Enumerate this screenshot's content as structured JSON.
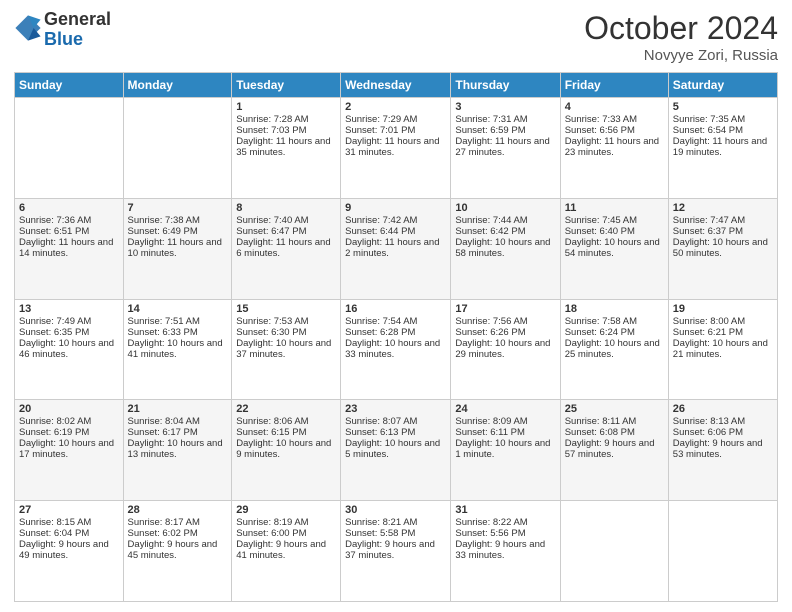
{
  "header": {
    "logo_general": "General",
    "logo_blue": "Blue",
    "month_title": "October 2024",
    "location": "Novyye Zori, Russia"
  },
  "days_of_week": [
    "Sunday",
    "Monday",
    "Tuesday",
    "Wednesday",
    "Thursday",
    "Friday",
    "Saturday"
  ],
  "weeks": [
    [
      {
        "day": "",
        "sunrise": "",
        "sunset": "",
        "daylight": ""
      },
      {
        "day": "",
        "sunrise": "",
        "sunset": "",
        "daylight": ""
      },
      {
        "day": "1",
        "sunrise": "Sunrise: 7:28 AM",
        "sunset": "Sunset: 7:03 PM",
        "daylight": "Daylight: 11 hours and 35 minutes."
      },
      {
        "day": "2",
        "sunrise": "Sunrise: 7:29 AM",
        "sunset": "Sunset: 7:01 PM",
        "daylight": "Daylight: 11 hours and 31 minutes."
      },
      {
        "day": "3",
        "sunrise": "Sunrise: 7:31 AM",
        "sunset": "Sunset: 6:59 PM",
        "daylight": "Daylight: 11 hours and 27 minutes."
      },
      {
        "day": "4",
        "sunrise": "Sunrise: 7:33 AM",
        "sunset": "Sunset: 6:56 PM",
        "daylight": "Daylight: 11 hours and 23 minutes."
      },
      {
        "day": "5",
        "sunrise": "Sunrise: 7:35 AM",
        "sunset": "Sunset: 6:54 PM",
        "daylight": "Daylight: 11 hours and 19 minutes."
      }
    ],
    [
      {
        "day": "6",
        "sunrise": "Sunrise: 7:36 AM",
        "sunset": "Sunset: 6:51 PM",
        "daylight": "Daylight: 11 hours and 14 minutes."
      },
      {
        "day": "7",
        "sunrise": "Sunrise: 7:38 AM",
        "sunset": "Sunset: 6:49 PM",
        "daylight": "Daylight: 11 hours and 10 minutes."
      },
      {
        "day": "8",
        "sunrise": "Sunrise: 7:40 AM",
        "sunset": "Sunset: 6:47 PM",
        "daylight": "Daylight: 11 hours and 6 minutes."
      },
      {
        "day": "9",
        "sunrise": "Sunrise: 7:42 AM",
        "sunset": "Sunset: 6:44 PM",
        "daylight": "Daylight: 11 hours and 2 minutes."
      },
      {
        "day": "10",
        "sunrise": "Sunrise: 7:44 AM",
        "sunset": "Sunset: 6:42 PM",
        "daylight": "Daylight: 10 hours and 58 minutes."
      },
      {
        "day": "11",
        "sunrise": "Sunrise: 7:45 AM",
        "sunset": "Sunset: 6:40 PM",
        "daylight": "Daylight: 10 hours and 54 minutes."
      },
      {
        "day": "12",
        "sunrise": "Sunrise: 7:47 AM",
        "sunset": "Sunset: 6:37 PM",
        "daylight": "Daylight: 10 hours and 50 minutes."
      }
    ],
    [
      {
        "day": "13",
        "sunrise": "Sunrise: 7:49 AM",
        "sunset": "Sunset: 6:35 PM",
        "daylight": "Daylight: 10 hours and 46 minutes."
      },
      {
        "day": "14",
        "sunrise": "Sunrise: 7:51 AM",
        "sunset": "Sunset: 6:33 PM",
        "daylight": "Daylight: 10 hours and 41 minutes."
      },
      {
        "day": "15",
        "sunrise": "Sunrise: 7:53 AM",
        "sunset": "Sunset: 6:30 PM",
        "daylight": "Daylight: 10 hours and 37 minutes."
      },
      {
        "day": "16",
        "sunrise": "Sunrise: 7:54 AM",
        "sunset": "Sunset: 6:28 PM",
        "daylight": "Daylight: 10 hours and 33 minutes."
      },
      {
        "day": "17",
        "sunrise": "Sunrise: 7:56 AM",
        "sunset": "Sunset: 6:26 PM",
        "daylight": "Daylight: 10 hours and 29 minutes."
      },
      {
        "day": "18",
        "sunrise": "Sunrise: 7:58 AM",
        "sunset": "Sunset: 6:24 PM",
        "daylight": "Daylight: 10 hours and 25 minutes."
      },
      {
        "day": "19",
        "sunrise": "Sunrise: 8:00 AM",
        "sunset": "Sunset: 6:21 PM",
        "daylight": "Daylight: 10 hours and 21 minutes."
      }
    ],
    [
      {
        "day": "20",
        "sunrise": "Sunrise: 8:02 AM",
        "sunset": "Sunset: 6:19 PM",
        "daylight": "Daylight: 10 hours and 17 minutes."
      },
      {
        "day": "21",
        "sunrise": "Sunrise: 8:04 AM",
        "sunset": "Sunset: 6:17 PM",
        "daylight": "Daylight: 10 hours and 13 minutes."
      },
      {
        "day": "22",
        "sunrise": "Sunrise: 8:06 AM",
        "sunset": "Sunset: 6:15 PM",
        "daylight": "Daylight: 10 hours and 9 minutes."
      },
      {
        "day": "23",
        "sunrise": "Sunrise: 8:07 AM",
        "sunset": "Sunset: 6:13 PM",
        "daylight": "Daylight: 10 hours and 5 minutes."
      },
      {
        "day": "24",
        "sunrise": "Sunrise: 8:09 AM",
        "sunset": "Sunset: 6:11 PM",
        "daylight": "Daylight: 10 hours and 1 minute."
      },
      {
        "day": "25",
        "sunrise": "Sunrise: 8:11 AM",
        "sunset": "Sunset: 6:08 PM",
        "daylight": "Daylight: 9 hours and 57 minutes."
      },
      {
        "day": "26",
        "sunrise": "Sunrise: 8:13 AM",
        "sunset": "Sunset: 6:06 PM",
        "daylight": "Daylight: 9 hours and 53 minutes."
      }
    ],
    [
      {
        "day": "27",
        "sunrise": "Sunrise: 8:15 AM",
        "sunset": "Sunset: 6:04 PM",
        "daylight": "Daylight: 9 hours and 49 minutes."
      },
      {
        "day": "28",
        "sunrise": "Sunrise: 8:17 AM",
        "sunset": "Sunset: 6:02 PM",
        "daylight": "Daylight: 9 hours and 45 minutes."
      },
      {
        "day": "29",
        "sunrise": "Sunrise: 8:19 AM",
        "sunset": "Sunset: 6:00 PM",
        "daylight": "Daylight: 9 hours and 41 minutes."
      },
      {
        "day": "30",
        "sunrise": "Sunrise: 8:21 AM",
        "sunset": "Sunset: 5:58 PM",
        "daylight": "Daylight: 9 hours and 37 minutes."
      },
      {
        "day": "31",
        "sunrise": "Sunrise: 8:22 AM",
        "sunset": "Sunset: 5:56 PM",
        "daylight": "Daylight: 9 hours and 33 minutes."
      },
      {
        "day": "",
        "sunrise": "",
        "sunset": "",
        "daylight": ""
      },
      {
        "day": "",
        "sunrise": "",
        "sunset": "",
        "daylight": ""
      }
    ]
  ]
}
